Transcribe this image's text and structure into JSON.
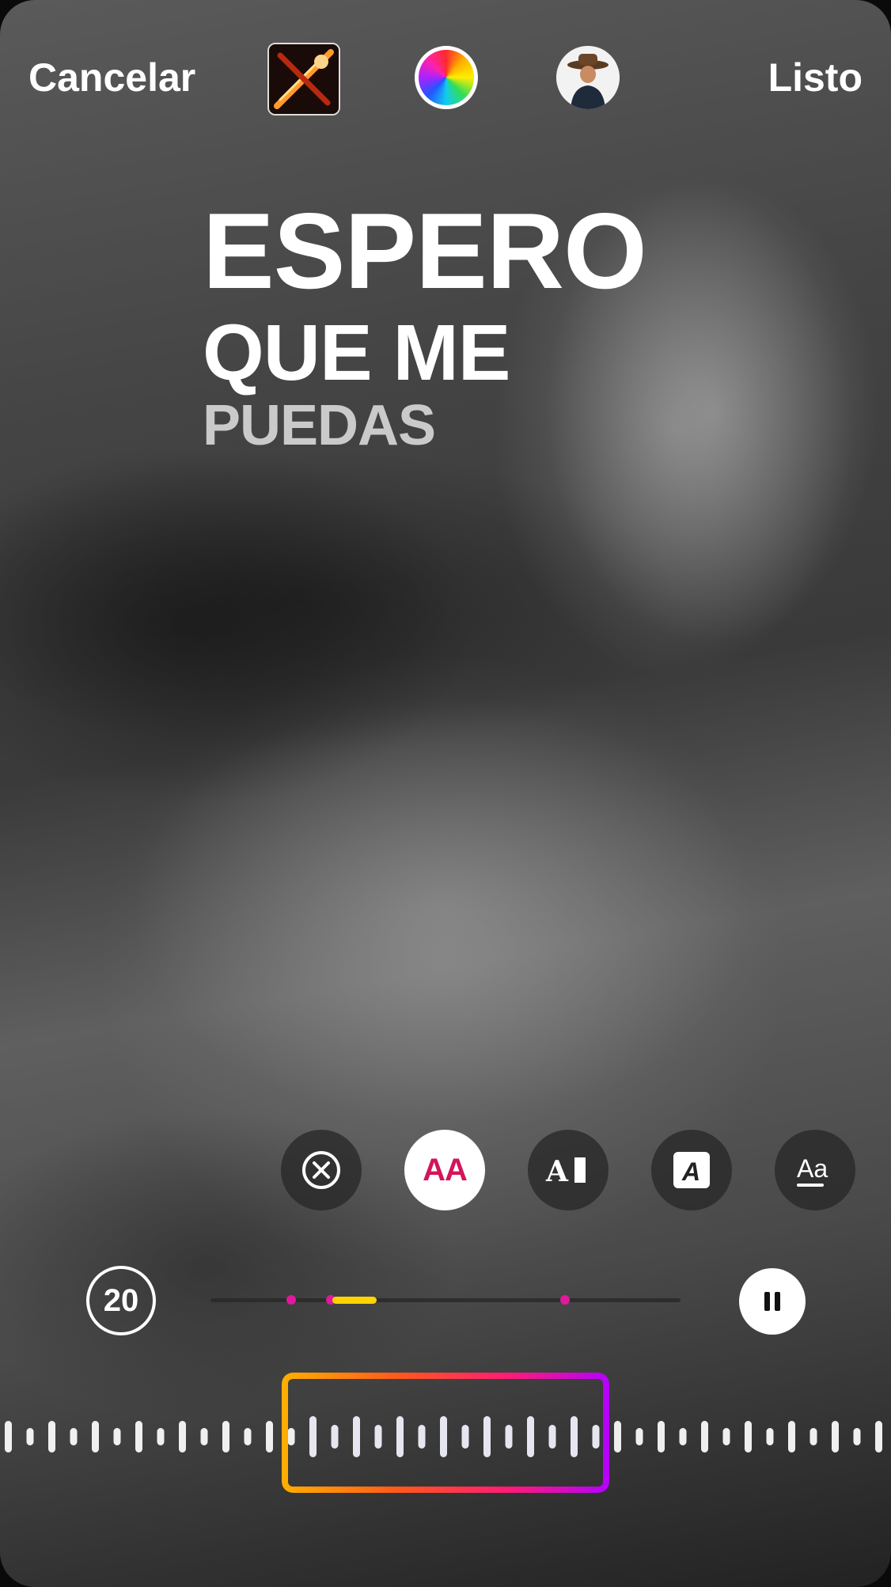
{
  "topbar": {
    "cancel_label": "Cancelar",
    "done_label": "Listo",
    "album_art_icon": "album-art-meteor",
    "color_icon": "color-wheel-icon",
    "avatar_icon": "cowboy-avatar"
  },
  "lyrics": {
    "line1": "ESPERO",
    "line2": "QUE ME",
    "line3": "PUEDAS"
  },
  "style_options": [
    {
      "name": "remove-style",
      "icon": "close-circle-icon"
    },
    {
      "name": "text-size-style",
      "icon": "aa-text-icon",
      "label": "AA",
      "selected": true,
      "accent": "#d4145a"
    },
    {
      "name": "typewriter-style",
      "icon": "text-cursor-icon",
      "label": "A"
    },
    {
      "name": "boxed-style",
      "icon": "boxed-a-icon",
      "label": "A"
    },
    {
      "name": "underline-style",
      "icon": "underline-aa-icon",
      "label": "Aa"
    }
  ],
  "player": {
    "duration_label": "20",
    "play_state": "playing",
    "pause_icon": "pause-icon"
  },
  "colors": {
    "accent_magenta": "#e0199c",
    "accent_yellow": "#ffd400",
    "frame_gradient": [
      "#ffb000",
      "#ff5a1a",
      "#ff1a78",
      "#b400ff"
    ]
  }
}
